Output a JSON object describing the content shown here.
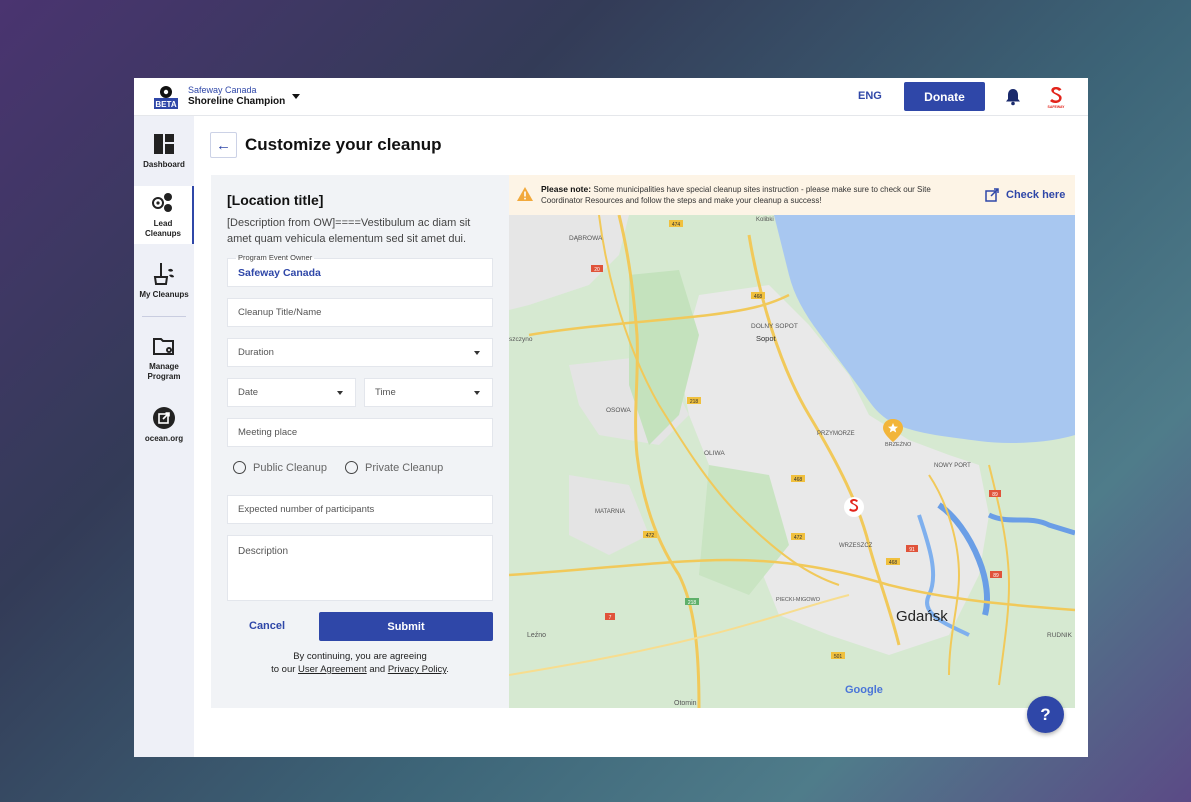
{
  "header": {
    "org_small": "Safeway Canada",
    "org_name": "Shoreline Champion",
    "logo_badge": "BETA",
    "language": "ENG",
    "donate_label": "Donate",
    "brand_text": "SAFEWAY"
  },
  "sidebar": {
    "items": [
      {
        "label": "Dashboard",
        "icon": "dashboard-icon"
      },
      {
        "label": "Lead Cleanups",
        "icon": "lead-cleanups-icon",
        "active": true
      },
      {
        "label": "My Cleanups",
        "icon": "my-cleanups-icon"
      },
      {
        "label": "Manage Program",
        "icon": "manage-program-icon"
      },
      {
        "label": "ocean.org",
        "icon": "external-link-icon"
      }
    ]
  },
  "page": {
    "title": "Customize your cleanup",
    "back_icon": "arrow-left-icon"
  },
  "form": {
    "location_title": "[Location title]",
    "location_description": "[Description from OW]====Vestibulum ac diam sit amet quam vehicula elementum sed sit amet dui.",
    "owner_label": "Program Event Owner",
    "owner_value": "Safeway Canada",
    "title_placeholder": "Cleanup Title/Name",
    "duration_placeholder": "Duration",
    "date_placeholder": "Date",
    "time_placeholder": "Time",
    "meeting_placeholder": "Meeting place",
    "radio_public": "Public Cleanup",
    "radio_private": "Private Cleanup",
    "participants_placeholder": "Expected number of participants",
    "description_placeholder": "Description",
    "cancel_label": "Cancel",
    "submit_label": "Submit",
    "legal_prefix": "By continuing, you are agreeing",
    "legal_to_our": "to our",
    "legal_user_agreement": "User Agreement",
    "legal_and": "and",
    "legal_privacy": "Privacy Policy",
    "legal_suffix": "."
  },
  "notice": {
    "bold": "Please note:",
    "text": "Some municipalities have special cleanup sites instruction - please make sure to check our Site Coordinator Resources and follow the steps and make your cleanup a success!",
    "link": "Check here"
  },
  "map": {
    "labels": {
      "kolibki": "Kolibki",
      "dabrowa": "DĄBROWA",
      "dolny_sopot": "DOLNY SOPOT",
      "sopot": "Sopot",
      "szczyno": "szczyno",
      "osowa": "OSOWA",
      "przymorze": "PRZYMORZE",
      "brzezno": "BRZEŹNO",
      "oliwa": "OLIWA",
      "nowy_port": "NOWY PORT",
      "matarnia": "MATARNIA",
      "wrzeszcz": "WRZESZCZ",
      "piecki": "PIECKI-MIGOWO",
      "gdansk": "Gdańsk",
      "rudniki": "RUDNIK",
      "lezno": "Leźno",
      "otomin": "Otomin",
      "google": "Google"
    },
    "road_numbers": [
      "474",
      "20",
      "468",
      "218",
      "468",
      "472",
      "472",
      "218",
      "7",
      "468",
      "501",
      "91",
      "89",
      "89"
    ],
    "colors": {
      "water": "#a8c7f0",
      "land": "#d8ead4",
      "urban": "#ececec",
      "road_yellow": "#f3d57a"
    }
  },
  "help_label": "?",
  "accent_color": "#2f47a8"
}
